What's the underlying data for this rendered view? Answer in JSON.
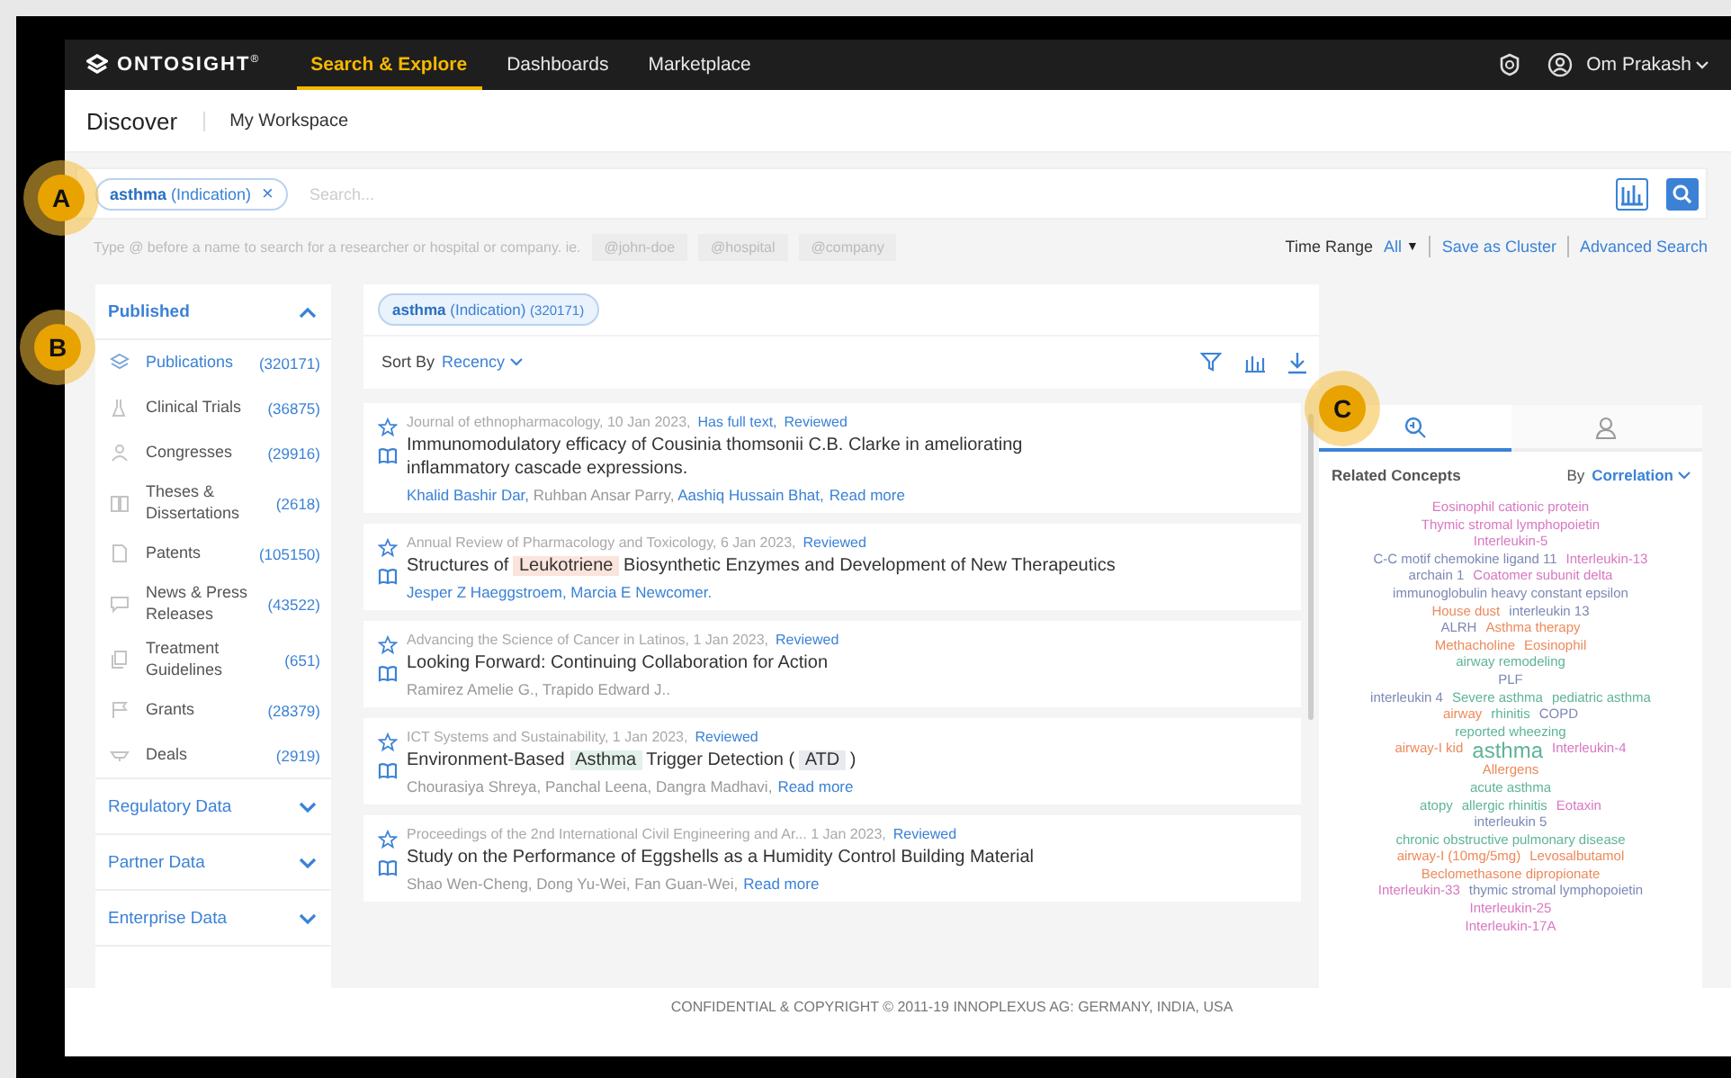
{
  "nav": {
    "logo": "ONTOSIGHT",
    "logo_mark": "®",
    "tabs": [
      {
        "label": "Search & Explore",
        "selected": true
      },
      {
        "label": "Dashboards",
        "selected": false
      },
      {
        "label": "Marketplace",
        "selected": false
      }
    ],
    "user": "Om Prakash"
  },
  "subnav": [
    {
      "label": "Discover",
      "selected": true
    },
    {
      "label": "My Workspace",
      "selected": false
    }
  ],
  "search": {
    "chip_term": "asthma",
    "chip_type": "(Indication)",
    "chip_remove": "×",
    "placeholder": "Search..."
  },
  "hint": {
    "text": "Type @ before a name to search for a researcher or hospital or company. ie.",
    "examples": [
      "@john-doe",
      "@hospital",
      "@company"
    ]
  },
  "options": {
    "time_range_label": "Time Range",
    "time_range_value": "All",
    "time_range_caret": "▼",
    "links": [
      "Save as Cluster",
      "Advanced Search"
    ]
  },
  "sidebar": {
    "sections": [
      {
        "title": "Published",
        "expanded": true,
        "items": [
          {
            "label": "Publications",
            "count": "(320171)",
            "selected": true
          },
          {
            "label": "Clinical Trials",
            "count": "(36875)",
            "selected": false
          },
          {
            "label": "Congresses",
            "count": "(29916)",
            "selected": false
          },
          {
            "label": "Theses & Dissertations",
            "count": "(2618)",
            "selected": false
          },
          {
            "label": "Patents",
            "count": "(105150)",
            "selected": false
          },
          {
            "label": "News & Press Releases",
            "count": "(43522)",
            "selected": false
          },
          {
            "label": "Treatment Guidelines",
            "count": "(651)",
            "selected": false
          },
          {
            "label": "Grants",
            "count": "(28379)",
            "selected": false
          },
          {
            "label": "Deals",
            "count": "(2919)",
            "selected": false
          }
        ]
      },
      {
        "title": "Regulatory Data",
        "expanded": false
      },
      {
        "title": "Partner Data",
        "expanded": false
      },
      {
        "title": "Enterprise Data",
        "expanded": false
      }
    ]
  },
  "results": {
    "chip_term": "asthma",
    "chip_type": "(Indication)",
    "chip_count": "(320171)",
    "sort_label": "Sort By",
    "sort_value": "Recency",
    "cards": [
      {
        "source": "Journal of ethnopharmacology, 10 Jan 2023,",
        "tags": [
          "Has full text,",
          "Reviewed"
        ],
        "title": [
          {
            "text": "Immunomodulatory efficacy of Cousinia thomsonii C.B. Clarke in ameliorating inflammatory cascade expressions."
          }
        ],
        "authors": [
          {
            "name": "Khalid Bashir Dar,",
            "linked": true
          },
          {
            "name": "Ruhban Ansar Parry,",
            "linked": false
          },
          {
            "name": "Aashiq Hussain Bhat,",
            "linked": true
          }
        ],
        "read_more": "Read more"
      },
      {
        "source": "Annual Review of Pharmacology and Toxicology, 6 Jan 2023,",
        "tags": [
          "Reviewed"
        ],
        "title": [
          {
            "text": "Structures of"
          },
          {
            "text": "Leukotriene",
            "color": "#fbe4dc"
          },
          {
            "text": "Biosynthetic Enzymes and Development of New Therapeutics"
          }
        ],
        "authors": [
          {
            "name": "Jesper Z Haeggstroem, Marcia E Newcomer.",
            "linked": true
          }
        ]
      },
      {
        "source": "Advancing the Science of Cancer in Latinos, 1 Jan 2023,",
        "tags": [
          "Reviewed"
        ],
        "title": [
          {
            "text": "Looking Forward: Continuing Collaboration for Action"
          }
        ],
        "authors": [
          {
            "name": "Ramirez Amelie G., Trapido Edward J..",
            "linked": false
          }
        ]
      },
      {
        "source": "ICT Systems and Sustainability, 1 Jan 2023,",
        "tags": [
          "Reviewed"
        ],
        "title": [
          {
            "text": "Environment-Based"
          },
          {
            "text": "Asthma",
            "color": "#e2f2ea"
          },
          {
            "text": "Trigger Detection ("
          },
          {
            "text": "ATD",
            "color": "#e8eaf0"
          },
          {
            "text": ")"
          }
        ],
        "authors": [
          {
            "name": "Chourasiya Shreya, Panchal Leena, Dangra Madhavi,",
            "linked": false
          }
        ],
        "read_more": "Read more"
      },
      {
        "source": "Proceedings of the 2nd International Civil Engineering and Ar...  1 Jan 2023,",
        "tags": [
          "Reviewed"
        ],
        "title": [
          {
            "text": "Study on the Performance of Eggshells as a Humidity Control Building Material"
          }
        ],
        "authors": [
          {
            "name": "Shao Wen-Cheng, Dong Yu-Wei, Fan Guan-Wei,",
            "linked": false
          }
        ],
        "read_more": "Read more"
      }
    ]
  },
  "concepts": {
    "tabs": [
      {
        "selected": true
      },
      {
        "selected": false
      }
    ],
    "title": "Related Concepts",
    "by_label": "By",
    "by_value": "Correlation",
    "lines": [
      [
        {
          "text": "Eosinophil cationic protein",
          "color": "#d877c0"
        }
      ],
      [
        {
          "text": "Thymic stromal lymphopoietin",
          "color": "#d877c0"
        }
      ],
      [
        {
          "text": "Interleukin-5",
          "color": "#d877c0"
        }
      ],
      [
        {
          "text": "C-C motif chemokine ligand 11",
          "color": "#7d88b5"
        },
        {
          "text": "Interleukin-13",
          "color": "#d877c0"
        }
      ],
      [
        {
          "text": "archain 1",
          "color": "#7d88b5"
        },
        {
          "text": "Coatomer subunit delta",
          "color": "#d877c0"
        }
      ],
      [
        {
          "text": "immunoglobulin heavy constant epsilon",
          "color": "#7d88b5"
        }
      ],
      [
        {
          "text": "House dust",
          "color": "#ec8a5c"
        },
        {
          "text": "interleukin 13",
          "color": "#7d88b5"
        }
      ],
      [
        {
          "text": "ALRH",
          "color": "#7d88b5"
        },
        {
          "text": "Asthma therapy",
          "color": "#ec8a5c"
        }
      ],
      [
        {
          "text": "Methacholine",
          "color": "#ec8a5c"
        },
        {
          "text": "Eosinophil",
          "color": "#ec8a5c"
        }
      ],
      [
        {
          "text": "airway remodeling",
          "color": "#5fb39a"
        }
      ],
      [
        {
          "text": "PLF",
          "color": "#7d88b5"
        }
      ],
      [
        {
          "text": "interleukin 4",
          "color": "#7d88b5"
        },
        {
          "text": "Severe asthma",
          "color": "#5fb39a"
        },
        {
          "text": "pediatric asthma",
          "color": "#5fb39a"
        }
      ],
      [
        {
          "text": "airway",
          "color": "#ec8a5c"
        },
        {
          "text": "rhinitis",
          "color": "#5fb39a"
        },
        {
          "text": "COPD",
          "color": "#7d88b5"
        }
      ],
      [
        {
          "text": "reported wheezing",
          "color": "#5fb39a"
        }
      ],
      [
        {
          "text": "airway-I kid",
          "color": "#ec8a5c"
        },
        {
          "text": "asthma",
          "color": "#5fb39a",
          "emphasis": true
        },
        {
          "text": "Interleukin-4",
          "color": "#d877c0"
        }
      ],
      [
        {
          "text": "Allergens",
          "color": "#ec8a5c"
        }
      ],
      [
        {
          "text": "acute asthma",
          "color": "#5fb39a"
        }
      ],
      [
        {
          "text": "atopy",
          "color": "#5fb39a"
        },
        {
          "text": "allergic rhinitis",
          "color": "#5fb39a"
        },
        {
          "text": "Eotaxin",
          "color": "#d877c0"
        }
      ],
      [
        {
          "text": "interleukin 5",
          "color": "#7d88b5"
        }
      ],
      [
        {
          "text": "chronic obstructive pulmonary disease",
          "color": "#5fb39a"
        }
      ],
      [
        {
          "text": "airway-I (10mg/5mg)",
          "color": "#ec8a5c"
        },
        {
          "text": "Levosalbutamol",
          "color": "#ec8a5c"
        }
      ],
      [
        {
          "text": "Beclomethasone dipropionate",
          "color": "#ec8a5c"
        }
      ],
      [
        {
          "text": "Interleukin-33",
          "color": "#d877c0"
        },
        {
          "text": "thymic stromal lymphopoietin",
          "color": "#7d88b5"
        }
      ],
      [
        {
          "text": "Interleukin-25",
          "color": "#d877c0"
        }
      ],
      [
        {
          "text": "Interleukin-17A",
          "color": "#d877c0"
        }
      ]
    ]
  },
  "footer": "CONFIDENTIAL & COPYRIGHT © 2011-19 INNOPLEXUS AG: GERMANY, INDIA, USA",
  "callouts": [
    {
      "label": "A"
    },
    {
      "label": "B"
    },
    {
      "label": "C"
    }
  ]
}
